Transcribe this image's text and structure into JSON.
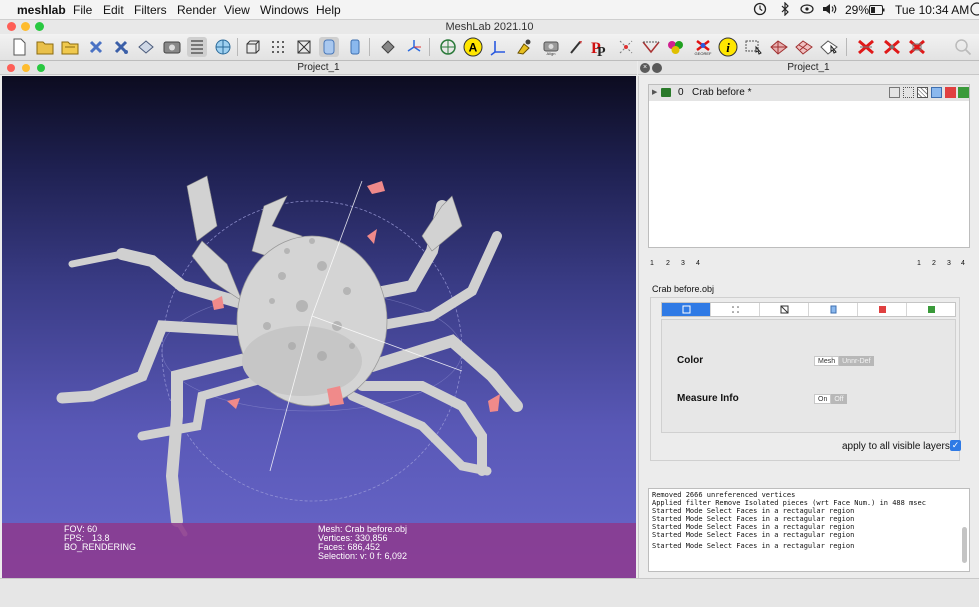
{
  "menubar": {
    "apple_symbol": "",
    "app_name": "meshlab",
    "items": [
      "File",
      "Edit",
      "Filters",
      "Render",
      "View",
      "Windows",
      "Help"
    ],
    "battery": "29%",
    "clock": "Tue 10:34 AM"
  },
  "window": {
    "title": "MeshLab 2021.10"
  },
  "toolbar": {
    "icons": [
      "new-file-icon",
      "open-folder-icon",
      "open-project-icon",
      "reload-icon",
      "reload-all-icon",
      "save-icon",
      "snapshot-icon",
      "layers-icon",
      "globe-icon",
      "bbox-icon",
      "points-icon",
      "wireframe-icon",
      "flat-icon",
      "smooth-icon",
      "lighting-icon",
      "axes-icon",
      "measure-icon",
      "annotation-a-icon",
      "reference-frame-icon",
      "paint-icon",
      "camera-icon",
      "brush-icon",
      "pick-points-icon",
      "select-vertices-icon",
      "select-connected-icon",
      "paint-colors-icon",
      "georef-icon",
      "info-icon",
      "select-faces-icon",
      "select-faces-rect-icon",
      "select-paint-icon",
      "select-polygon-icon",
      "delete-faces-icon",
      "delete-vertices-icon",
      "delete-all-icon",
      "search-icon"
    ],
    "align_caption": "Align",
    "georef_caption": "GEOREF"
  },
  "viewport": {
    "title": "Project_1",
    "fov_label": "FOV: 60",
    "fps_label": "FPS:",
    "fps_value": "13.8",
    "render_mode": "BO_RENDERING",
    "mesh_label": "Mesh: Crab before.obj",
    "vertices_label": "Vertices: 330,856",
    "faces_label": "Faces: 686,452",
    "selection_label": "Selection: v: 0 f: 6,092"
  },
  "right_panel": {
    "title": "Project_1",
    "layer": {
      "index": "0",
      "name": "Crab before *"
    },
    "slots_left": [
      "1",
      "2",
      "3",
      "4"
    ],
    "slots_right": [
      "1",
      "2",
      "3",
      "4"
    ],
    "mesh_name": "Crab before.obj",
    "color_label": "Color",
    "color_options": [
      "Mesh",
      "Unnr-Def"
    ],
    "color_selected": "Mesh",
    "measure_label": "Measure Info",
    "measure_options": [
      "On",
      "Off"
    ],
    "measure_selected": "On",
    "apply_all_label": "apply to all visible layers",
    "apply_all_checked": true
  },
  "log": {
    "lines": [
      "Removed 2666 unreferenced vertices",
      "Applied filter Remove Isolated pieces (wrt Face Num.) in 488 msec",
      "Started Mode Select Faces in a rectagular region",
      "Started Mode Select Faces in a rectagular region",
      "Started Mode Select Faces in a rectagular region",
      "Started Mode Select Faces in a rectagular region",
      "Started Mode Select Faces in a rectagular region"
    ]
  },
  "colors": {
    "accent": "#2f7ae5",
    "info_overlay": "#8c3a8e",
    "viewport_top": "#0c0c20",
    "viewport_bottom": "#6a68cc",
    "mesh": "#d0d0d0",
    "selection": "#f08a8a"
  }
}
